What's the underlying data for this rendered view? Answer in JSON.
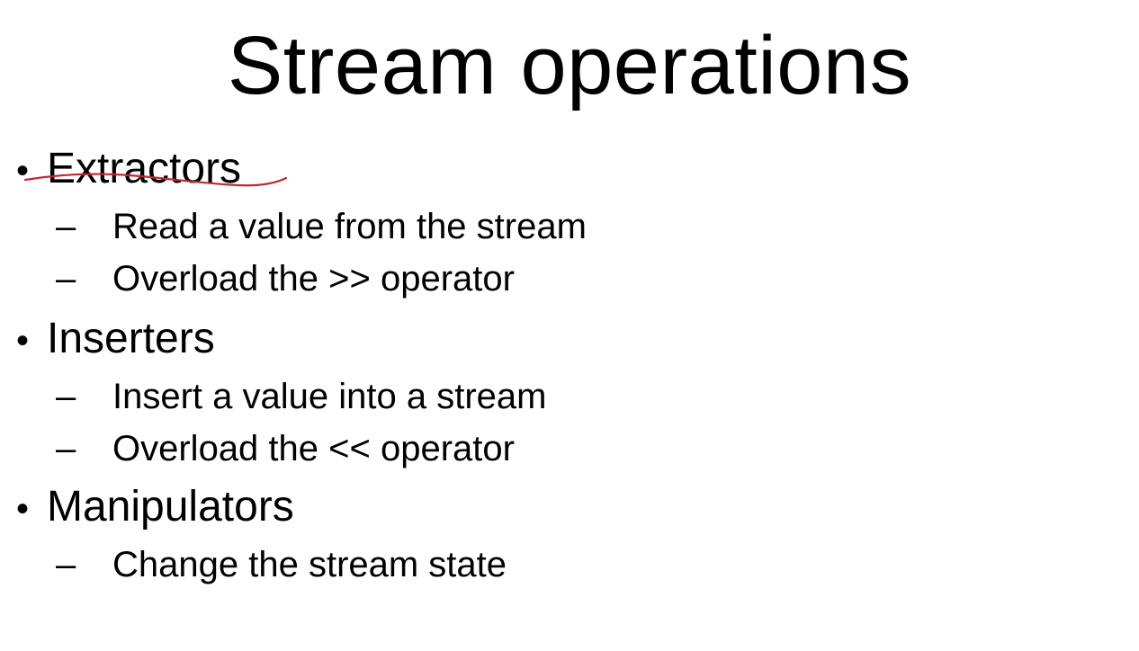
{
  "slide": {
    "title": "Stream operations",
    "bullet_glyph": "•",
    "dash_glyph": "–",
    "sections": [
      {
        "heading": "Extractors",
        "items": [
          "Read a value from the stream",
          "Overload the >> operator"
        ]
      },
      {
        "heading": "Inserters",
        "items": [
          "Insert a value into a stream",
          "Overload the << operator"
        ]
      },
      {
        "heading": "Manipulators",
        "items": [
          "Change the stream state"
        ]
      }
    ],
    "annotation_color": "#c0282d"
  }
}
